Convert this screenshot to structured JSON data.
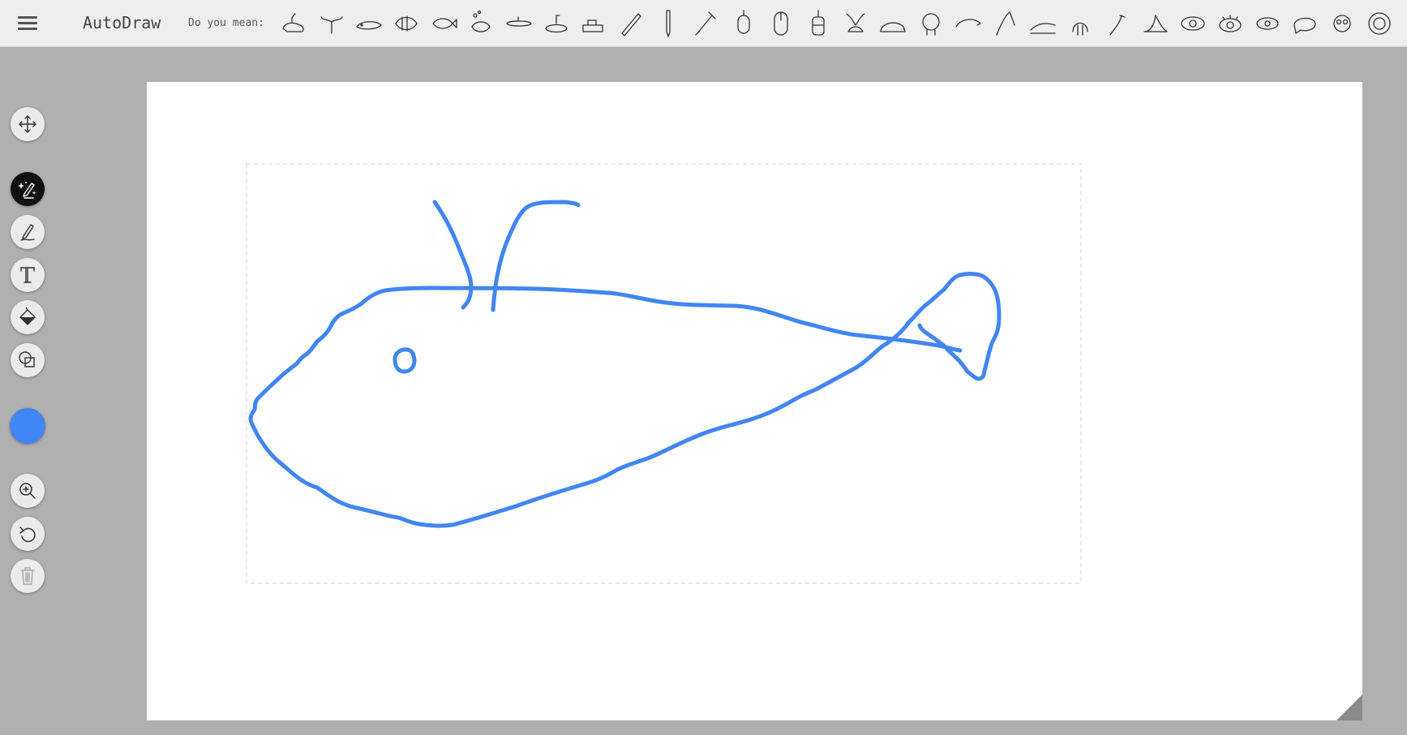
{
  "app": {
    "title": "AutoDraw",
    "menu_icon": "hamburger-menu-icon"
  },
  "suggestions": {
    "label": "Do you mean:",
    "items": [
      "whale-spout",
      "whale-tail",
      "whale",
      "fish-striped",
      "fish",
      "fish-bubbles",
      "submarine",
      "submarine-periscope",
      "submarine-small",
      "pencil",
      "pen",
      "syringe",
      "mouse-wired",
      "computer-mouse",
      "mouse-scroll",
      "squirrel",
      "snail",
      "hedgehog",
      "dolphin",
      "dolphin-jump",
      "dolphin-wave",
      "walrus",
      "pelican",
      "seal",
      "eye",
      "eye-lashes",
      "eye-simple",
      "blob",
      "owl-face",
      "lion"
    ]
  },
  "tools": {
    "select": "select-move-icon",
    "autodraw": "autodraw-sparkle-pen-icon",
    "draw": "pen-icon",
    "type": "text-icon",
    "fill": "paint-bucket-icon",
    "shape": "shapes-icon",
    "zoom": "zoom-in-icon",
    "undo": "undo-icon",
    "delete": "trash-icon"
  },
  "colors": {
    "stroke": "#4285f4",
    "selected_color": "#4285f4",
    "active_tool_bg": "#111111"
  }
}
